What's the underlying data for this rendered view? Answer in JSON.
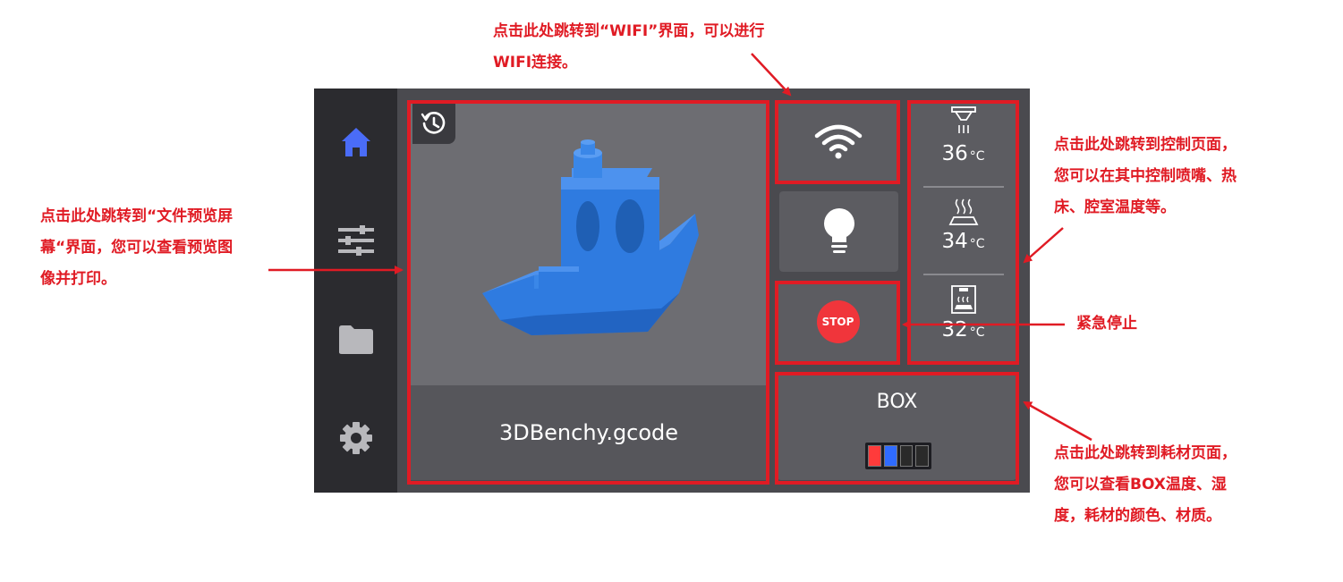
{
  "preview": {
    "filename": "3DBenchy.gcode"
  },
  "temperatures": [
    {
      "name": "nozzle",
      "value": "36",
      "unit": "°C"
    },
    {
      "name": "hotbed",
      "value": "34",
      "unit": "°C"
    },
    {
      "name": "chamber",
      "value": "32",
      "unit": "°C"
    }
  ],
  "stop": {
    "label": "STOP"
  },
  "box": {
    "label": "BOX",
    "slots": [
      "#ff3b3b",
      "#2f6bff",
      "#2a2a2a",
      "#2a2a2a"
    ]
  },
  "annotations": {
    "wifi": [
      "点击此处跳转到“WIFI”界面，可以进行",
      "WIFI连接。"
    ],
    "preview": [
      "点击此处跳转到“文件预览屏",
      "幕“界面，您可以查看预览图",
      "像并打印。"
    ],
    "control": [
      "点击此处跳转到控制页面，",
      "您可以在其中控制喷嘴、热",
      "床、腔室温度等。"
    ],
    "stop": [
      "紧急停止"
    ],
    "box": [
      "点击此处跳转到耗材页面，",
      "您可以查看BOX温度、湿",
      "度，耗材的颜色、材质。"
    ]
  },
  "colors": {
    "accent_red": "#e01b24",
    "home_active": "#4a6cf7",
    "boat_blue": "#2f7be0",
    "stop_red": "#f0353b"
  },
  "icons": [
    "home-icon",
    "settings-sliders-icon",
    "folder-icon",
    "gear-icon",
    "history-icon",
    "wifi-icon",
    "light-bulb-icon",
    "nozzle-icon",
    "hotbed-icon",
    "chamber-icon"
  ]
}
